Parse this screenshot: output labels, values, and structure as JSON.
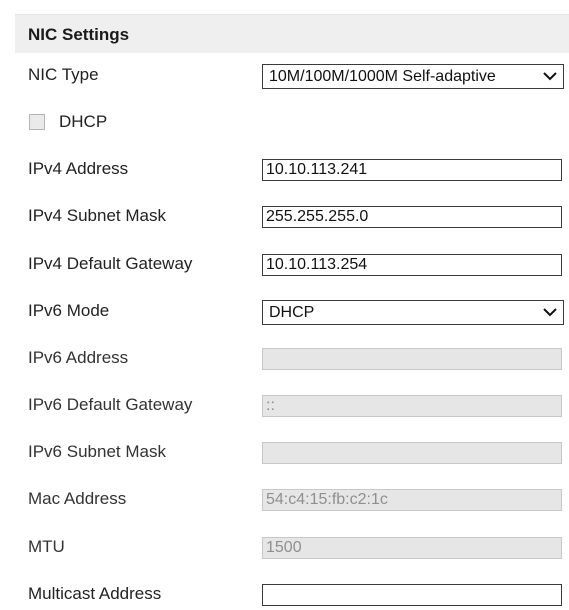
{
  "section": {
    "title": "NIC Settings"
  },
  "nic_type": {
    "label": "NIC Type",
    "value": "10M/100M/1000M Self-adaptive"
  },
  "dhcp": {
    "label": "DHCP",
    "checked": false
  },
  "ipv4_address": {
    "label": "IPv4 Address",
    "value": "10.10.113.241"
  },
  "ipv4_subnet_mask": {
    "label": "IPv4 Subnet Mask",
    "value": "255.255.255.0"
  },
  "ipv4_gateway": {
    "label": "IPv4 Default Gateway",
    "value": "10.10.113.254"
  },
  "ipv6_mode": {
    "label": "IPv6 Mode",
    "value": "DHCP"
  },
  "ipv6_address": {
    "label": "IPv6 Address",
    "value": ""
  },
  "ipv6_gateway": {
    "label": "IPv6 Default Gateway",
    "value": "::"
  },
  "ipv6_subnet_mask": {
    "label": "IPv6 Subnet Mask",
    "value": ""
  },
  "mac_address": {
    "label": "Mac Address",
    "value": "54:c4:15:fb:c2:1c"
  },
  "mtu": {
    "label": "MTU",
    "value": "1500"
  },
  "multicast_address": {
    "label": "Multicast Address",
    "value": ""
  }
}
